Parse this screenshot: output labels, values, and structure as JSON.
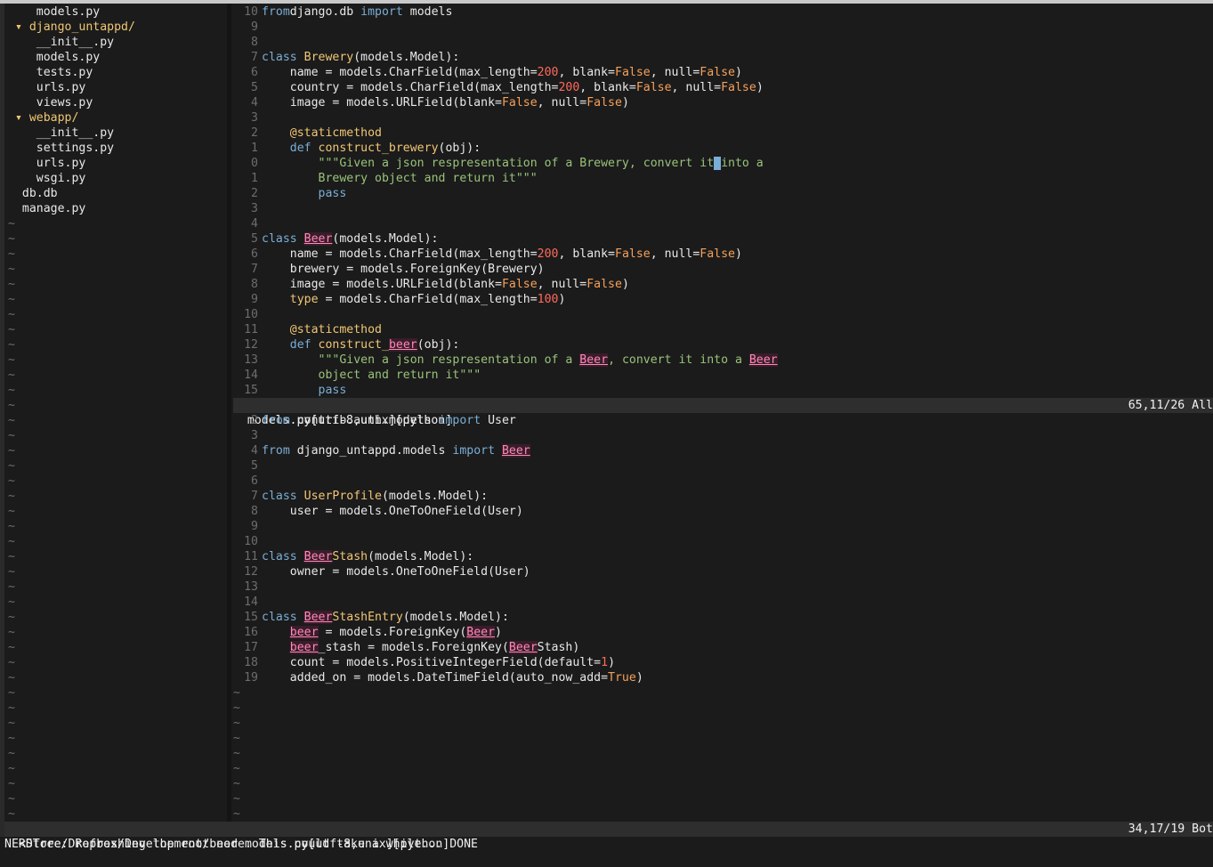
{
  "tree": [
    {
      "indent": "    ",
      "name": "models.py",
      "kind": "file"
    },
    {
      "indent": "  ",
      "name": "django_untappd/",
      "kind": "dir"
    },
    {
      "indent": "    ",
      "name": "__init__.py",
      "kind": "file"
    },
    {
      "indent": "    ",
      "name": "models.py",
      "kind": "file"
    },
    {
      "indent": "    ",
      "name": "tests.py",
      "kind": "file"
    },
    {
      "indent": "    ",
      "name": "urls.py",
      "kind": "file"
    },
    {
      "indent": "    ",
      "name": "views.py",
      "kind": "file"
    },
    {
      "indent": "  ",
      "name": "webapp/",
      "kind": "dir"
    },
    {
      "indent": "    ",
      "name": "__init__.py",
      "kind": "file"
    },
    {
      "indent": "    ",
      "name": "settings.py",
      "kind": "file"
    },
    {
      "indent": "    ",
      "name": "urls.py",
      "kind": "file"
    },
    {
      "indent": "    ",
      "name": "wsgi.py",
      "kind": "file"
    },
    {
      "indent": "  ",
      "name": "db.db",
      "kind": "file"
    },
    {
      "indent": "  ",
      "name": "manage.py",
      "kind": "file"
    }
  ],
  "tree_tilde_count": 40,
  "pane1": {
    "lines": [
      {
        "n": "10",
        "t": [
          [
            "kw",
            "from"
          ],
          [
            "",
            "django.db "
          ],
          [
            "kw",
            "import"
          ],
          [
            "",
            " models"
          ]
        ]
      },
      {
        "n": "9",
        "t": []
      },
      {
        "n": "8",
        "t": []
      },
      {
        "n": "7",
        "t": [
          [
            "kw",
            "class "
          ],
          [
            "cls",
            "Brewery"
          ],
          [
            "",
            "(models.Model):"
          ]
        ]
      },
      {
        "n": "6",
        "t": [
          [
            "",
            "    name = models.CharField(max_length="
          ],
          [
            "numv",
            "200"
          ],
          [
            "",
            ", blank="
          ],
          [
            "const",
            "False"
          ],
          [
            "",
            ", null="
          ],
          [
            "const",
            "False"
          ],
          [
            "",
            ")"
          ]
        ]
      },
      {
        "n": "5",
        "t": [
          [
            "",
            "    country = models.CharField(max_length="
          ],
          [
            "numv",
            "200"
          ],
          [
            "",
            ", blank="
          ],
          [
            "const",
            "False"
          ],
          [
            "",
            ", null="
          ],
          [
            "const",
            "False"
          ],
          [
            "",
            ")"
          ]
        ]
      },
      {
        "n": "4",
        "t": [
          [
            "",
            "    image = models.URLField(blank="
          ],
          [
            "const",
            "False"
          ],
          [
            "",
            ", null="
          ],
          [
            "const",
            "False"
          ],
          [
            "",
            ")"
          ]
        ]
      },
      {
        "n": "3",
        "t": []
      },
      {
        "n": "2",
        "t": [
          [
            "",
            "    "
          ],
          [
            "dec",
            "@staticmethod"
          ]
        ]
      },
      {
        "n": "1",
        "t": [
          [
            "",
            "    "
          ],
          [
            "kw",
            "def "
          ],
          [
            "fn",
            "construct_brewery"
          ],
          [
            "",
            "(obj):"
          ]
        ]
      },
      {
        "n": "0",
        "t": [
          [
            "",
            "        "
          ],
          [
            "str",
            "\"\"\"Given a json respresentation of a Brewery, convert it"
          ],
          [
            "cursor",
            " "
          ],
          [
            "str",
            "into a"
          ]
        ]
      },
      {
        "n": "1",
        "t": [
          [
            "",
            "        "
          ],
          [
            "str",
            "Brewery object and return it\"\"\""
          ]
        ]
      },
      {
        "n": "2",
        "t": [
          [
            "",
            "        "
          ],
          [
            "kw",
            "pass"
          ]
        ]
      },
      {
        "n": "3",
        "t": []
      },
      {
        "n": "4",
        "t": []
      },
      {
        "n": "5",
        "t": [
          [
            "kw",
            "class "
          ],
          [
            "hl",
            "Beer"
          ],
          [
            "",
            "(models.Model):"
          ]
        ]
      },
      {
        "n": "6",
        "t": [
          [
            "",
            "    name = models.CharField(max_length="
          ],
          [
            "numv",
            "200"
          ],
          [
            "",
            ", blank="
          ],
          [
            "const",
            "False"
          ],
          [
            "",
            ", null="
          ],
          [
            "const",
            "False"
          ],
          [
            "",
            ")"
          ]
        ]
      },
      {
        "n": "7",
        "t": [
          [
            "",
            "    brewery = models.ForeignKey(Brewery)"
          ]
        ]
      },
      {
        "n": "8",
        "t": [
          [
            "",
            "    image = models.URLField(blank="
          ],
          [
            "const",
            "False"
          ],
          [
            "",
            ", null="
          ],
          [
            "const",
            "False"
          ],
          [
            "",
            ")"
          ]
        ]
      },
      {
        "n": "9",
        "t": [
          [
            "",
            "    "
          ],
          [
            "dec",
            "type"
          ],
          [
            "",
            " = models.CharField(max_length="
          ],
          [
            "numv",
            "100"
          ],
          [
            "",
            ")"
          ]
        ]
      },
      {
        "n": "10",
        "t": []
      },
      {
        "n": "11",
        "t": [
          [
            "",
            "    "
          ],
          [
            "dec",
            "@staticmethod"
          ]
        ]
      },
      {
        "n": "12",
        "t": [
          [
            "",
            "    "
          ],
          [
            "kw",
            "def "
          ],
          [
            "fn",
            "construct_"
          ],
          [
            "hl",
            "beer"
          ],
          [
            "",
            "(obj):"
          ]
        ]
      },
      {
        "n": "13",
        "t": [
          [
            "",
            "        "
          ],
          [
            "str",
            "\"\"\"Given a json respresentation of a "
          ],
          [
            "hl",
            "Beer"
          ],
          [
            "str",
            ", convert it into a "
          ],
          [
            "hl",
            "Beer"
          ]
        ]
      },
      {
        "n": "14",
        "t": [
          [
            "",
            "        "
          ],
          [
            "str",
            "object and return it\"\"\""
          ]
        ]
      },
      {
        "n": "15",
        "t": [
          [
            "",
            "        "
          ],
          [
            "kw",
            "pass"
          ]
        ]
      }
    ],
    "status_left": "models.py[utf-8,unix][python]",
    "status_right": "65,11/26 All"
  },
  "pane2": {
    "lines": [
      {
        "n": "2",
        "t": [
          [
            "kw",
            "from"
          ],
          [
            "",
            " contrib.auth.models "
          ],
          [
            "kw",
            "import"
          ],
          [
            "",
            " User"
          ]
        ]
      },
      {
        "n": "3",
        "t": []
      },
      {
        "n": "4",
        "t": [
          [
            "kw",
            "from"
          ],
          [
            "",
            " django_untappd.models "
          ],
          [
            "kw",
            "import"
          ],
          [
            "",
            " "
          ],
          [
            "hl",
            "Beer"
          ]
        ]
      },
      {
        "n": "5",
        "t": []
      },
      {
        "n": "6",
        "t": []
      },
      {
        "n": "7",
        "t": [
          [
            "kw",
            "class "
          ],
          [
            "cls",
            "UserProfile"
          ],
          [
            "",
            "(models.Model):"
          ]
        ]
      },
      {
        "n": "8",
        "t": [
          [
            "",
            "    user = models.OneToOneField(User)"
          ]
        ]
      },
      {
        "n": "9",
        "t": []
      },
      {
        "n": "10",
        "t": []
      },
      {
        "n": "11",
        "t": [
          [
            "kw",
            "class "
          ],
          [
            "hl",
            "Beer"
          ],
          [
            "cls",
            "Stash"
          ],
          [
            "",
            "(models.Model):"
          ]
        ]
      },
      {
        "n": "12",
        "t": [
          [
            "",
            "    owner = models.OneToOneField(User)"
          ]
        ]
      },
      {
        "n": "13",
        "t": []
      },
      {
        "n": "14",
        "t": []
      },
      {
        "n": "15",
        "t": [
          [
            "kw",
            "class "
          ],
          [
            "hl",
            "Beer"
          ],
          [
            "cls",
            "StashEntry"
          ],
          [
            "",
            "(models.Model):"
          ]
        ]
      },
      {
        "n": "16",
        "t": [
          [
            "",
            "    "
          ],
          [
            "hl",
            "beer"
          ],
          [
            "",
            " = models.ForeignKey("
          ],
          [
            "hl",
            "Beer"
          ],
          [
            "",
            ")"
          ]
        ]
      },
      {
        "n": "17",
        "t": [
          [
            "",
            "    "
          ],
          [
            "hl",
            "beer"
          ],
          [
            "",
            "_stash = models.ForeignKey("
          ],
          [
            "hl",
            "Beer"
          ],
          [
            "",
            "Stash)"
          ]
        ]
      },
      {
        "n": "18",
        "t": [
          [
            "",
            "    count = models.PositiveIntegerField(default="
          ],
          [
            "numv",
            "1"
          ],
          [
            "",
            ")"
          ]
        ]
      },
      {
        "n": "19",
        "t": [
          [
            "",
            "    added_on = models.DateTimeField(auto_now_add="
          ],
          [
            "const",
            "True"
          ],
          [
            "",
            ")"
          ]
        ]
      }
    ],
    "tilde_count": 9
  },
  "status2_left": "<Store/Dropbox/Development/beer models.py[utf-8,unix][python]",
  "status2_right": "34,17/19 Bot",
  "cmdline": "NERDTree: Refreshing the root node. This could take a while... DONE",
  "colors": {
    "background": "#1b1b1b",
    "keyword": "#7aaed6",
    "class": "#f0c674",
    "string": "#99c27a",
    "constant": "#f5a05a",
    "number": "#ff6a5a",
    "highlight": "#ff88b8"
  }
}
